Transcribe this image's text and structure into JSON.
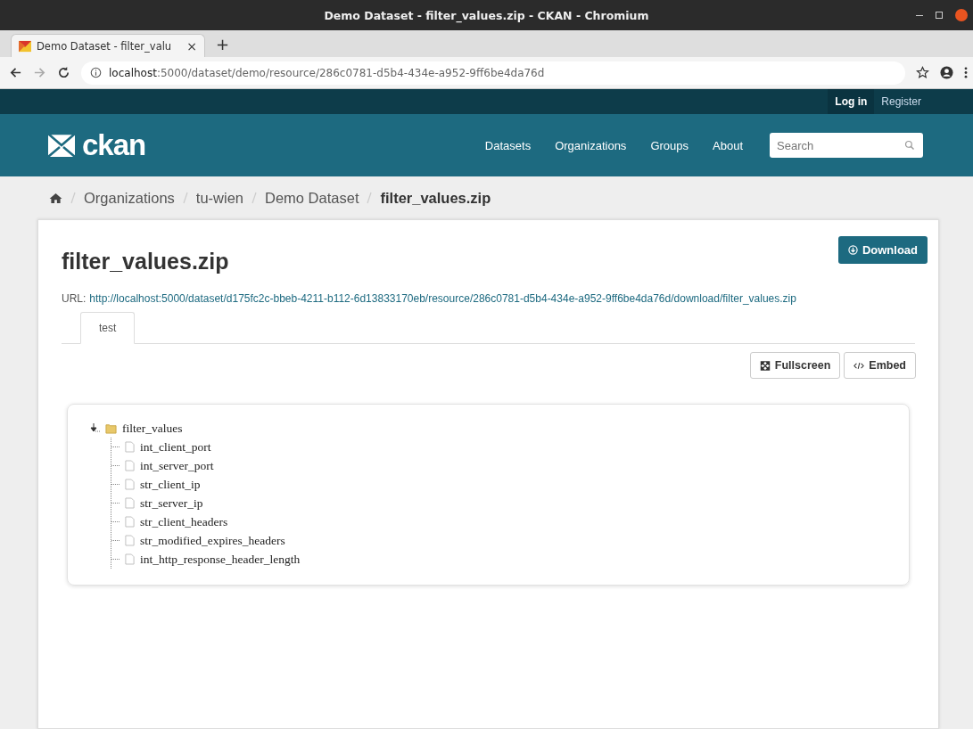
{
  "window": {
    "title": "Demo Dataset - filter_values.zip - CKAN - Chromium"
  },
  "browser": {
    "tab": {
      "title": "Demo Dataset - filter_valu",
      "close": "×"
    },
    "new_tab": "+",
    "address": {
      "host": "localhost",
      "path": ":5000/dataset/demo/resource/286c0781-d5b4-434e-a952-9ff6be4da76d"
    }
  },
  "account": {
    "links": [
      "Log in",
      "Register"
    ]
  },
  "masthead": {
    "logo": "ckan",
    "nav": [
      "Datasets",
      "Organizations",
      "Groups",
      "About"
    ],
    "search": {
      "placeholder": "Search"
    }
  },
  "breadcrumb": [
    {
      "label": "Organizations",
      "current": false
    },
    {
      "label": "tu-wien",
      "current": false
    },
    {
      "label": "Demo Dataset",
      "current": false
    },
    {
      "label": "filter_values.zip",
      "current": true
    }
  ],
  "resource": {
    "title": "filter_values.zip",
    "download": "Download",
    "url_label": "URL:",
    "url": "http://localhost:5000/dataset/d175fc2c-bbeb-4211-b112-6d13833170eb/resource/286c0781-d5b4-434e-a952-9ff6be4da76d/download/filter_values.zip"
  },
  "views": {
    "tabs": [
      {
        "label": "test",
        "selected": true
      }
    ],
    "buttons": [
      "Fullscreen",
      "Embed"
    ]
  },
  "tree": {
    "label": "filter_values",
    "expanded": true,
    "children": [
      {
        "label": "int_client_port"
      },
      {
        "label": "int_server_port"
      },
      {
        "label": "str_client_ip"
      },
      {
        "label": "str_server_ip"
      },
      {
        "label": "str_client_headers"
      },
      {
        "label": "str_modified_expires_headers"
      },
      {
        "label": "int_http_response_header_length"
      }
    ]
  }
}
